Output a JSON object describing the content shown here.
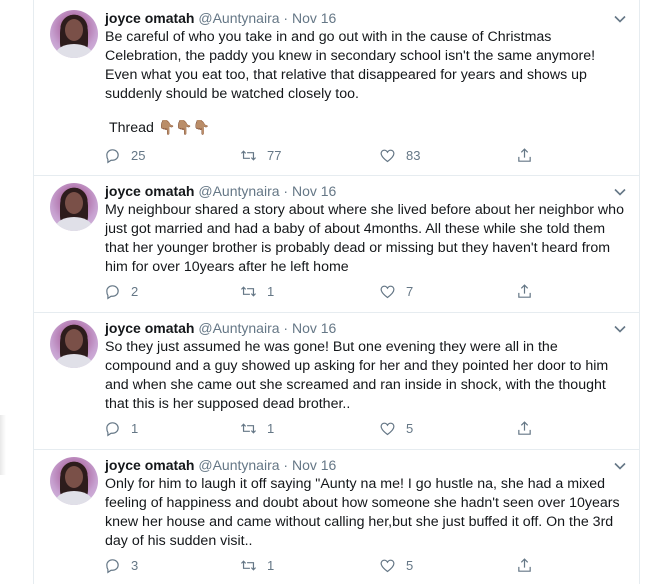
{
  "tweets": [
    {
      "name": "joyce omatah",
      "handle": "@Auntynaira",
      "separator": "·",
      "date": "Nov 16",
      "text": "Be careful of who you take in and go out with in the cause of Christmas Celebration, the paddy you knew in secondary school isn't the same anymore! Even what you eat too, that relative that disappeared for years and shows up suddenly should be watched closely too.",
      "thread_label": "Thread",
      "thread_emoji": "👇🏽👇🏽👇🏽",
      "replies": "25",
      "retweets": "77",
      "likes": "83"
    },
    {
      "name": "joyce omatah",
      "handle": "@Auntynaira",
      "separator": "·",
      "date": "Nov 16",
      "text": "My neighbour shared a story about where she lived before about her neighbor who just got married and had a baby of about 4months. All these while she told them that her younger brother is probably dead or missing but they haven't heard from him for over 10years after he left home",
      "replies": "2",
      "retweets": "1",
      "likes": "7"
    },
    {
      "name": "joyce omatah",
      "handle": "@Auntynaira",
      "separator": "·",
      "date": "Nov 16",
      "text": "So they just assumed he was gone! But one evening they were all in the compound and a guy showed up asking for her and they pointed her door to him and when she came out she screamed and ran inside in shock, with the thought that this is her supposed dead brother..",
      "replies": "1",
      "retweets": "1",
      "likes": "5"
    },
    {
      "name": "joyce omatah",
      "handle": "@Auntynaira",
      "separator": "·",
      "date": "Nov 16",
      "text": "Only for him to laugh it off saying \"Aunty na me! I go hustle na, she had a mixed feeling of happiness and doubt about how someone she hadn't seen over 10years knew her house and came without calling her,but she just buffed it off. On the 3rd day of his sudden visit..",
      "replies": "3",
      "retweets": "1",
      "likes": "5"
    }
  ],
  "colors": {
    "text": "#14171a",
    "secondary": "#657786",
    "border": "#e6ecf0"
  },
  "icons": [
    "reply-icon",
    "retweet-icon",
    "like-icon",
    "share-icon",
    "caret-down-icon",
    "point-down-emoji"
  ]
}
